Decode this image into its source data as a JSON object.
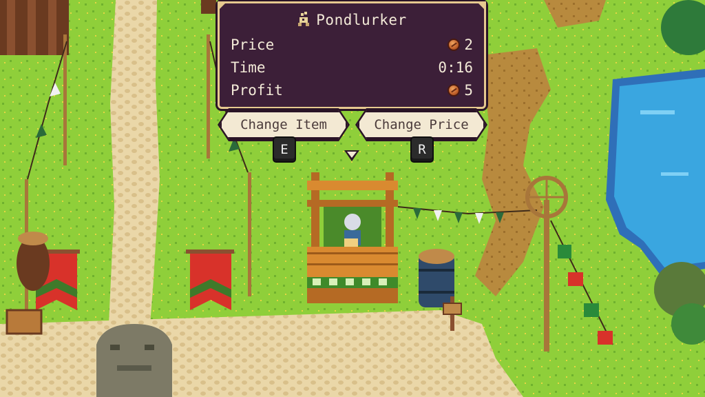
{
  "item": {
    "name": "Pondlurker",
    "icon": "pondlurker-icon"
  },
  "stats": [
    {
      "label": "Price",
      "value": "2",
      "icon": "coin-icon"
    },
    {
      "label": "Time",
      "value": "0:16",
      "icon": ""
    },
    {
      "label": "Profit",
      "value": "5",
      "icon": "coin-icon"
    }
  ],
  "actions": {
    "change_item": {
      "label": "Change Item",
      "key": "E"
    },
    "change_price": {
      "label": "Change Price",
      "key": "R"
    }
  },
  "colors": {
    "panel_bg": "#3c1f38",
    "panel_border": "#e6c98f",
    "button_bg": "#f3e9d3",
    "coin": "#c0602a",
    "grass": "#8fcf3a",
    "water": "#3aa6e0"
  }
}
